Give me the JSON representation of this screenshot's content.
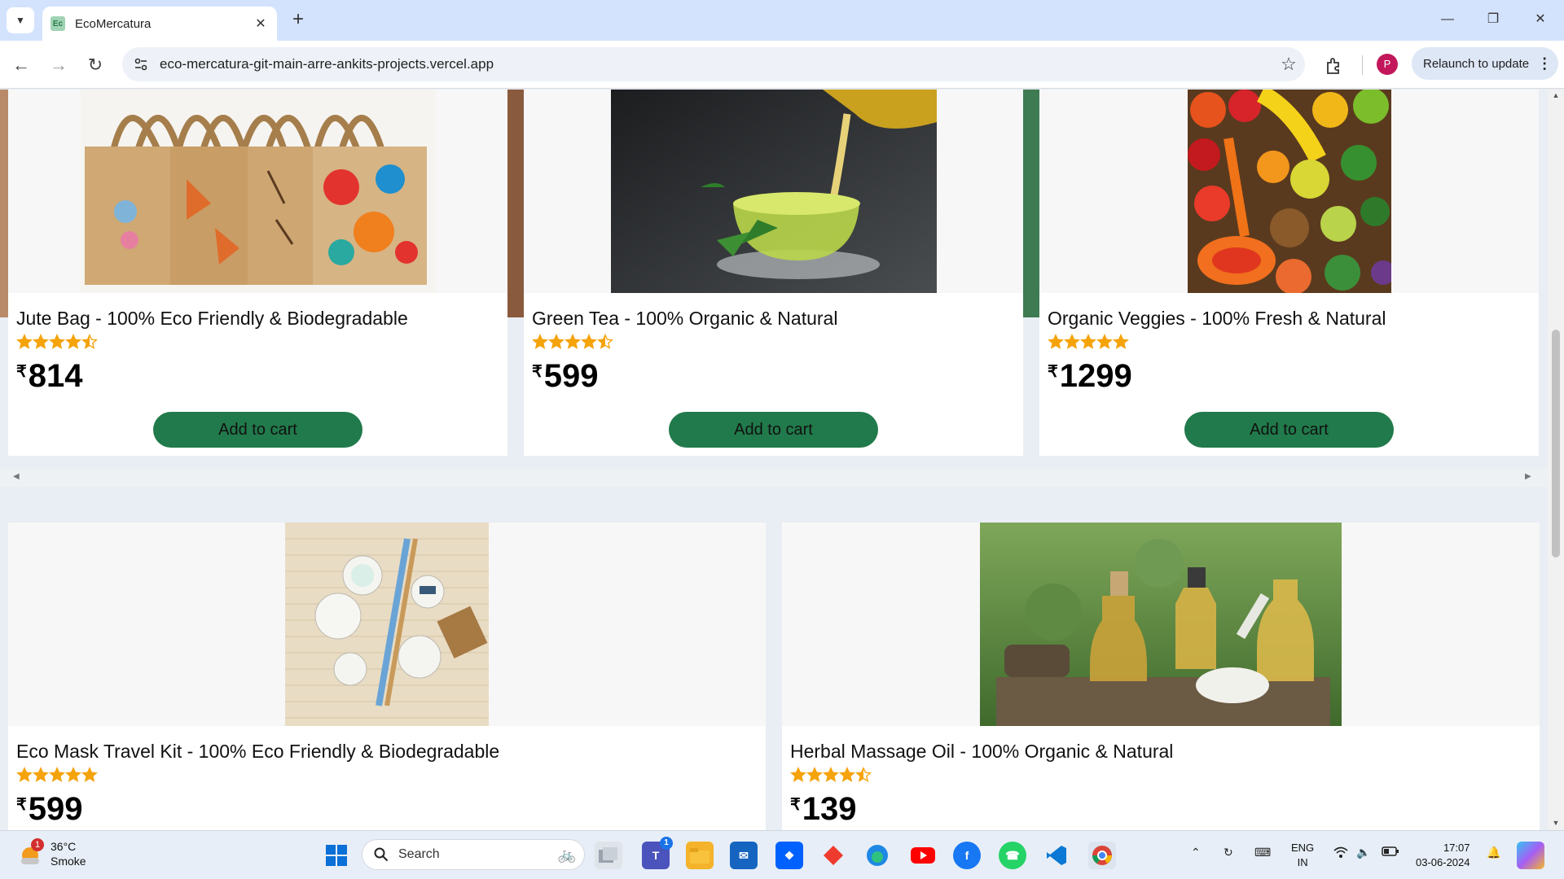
{
  "browser": {
    "tab_title": "EcoMercatura",
    "favicon_text": "Ec",
    "url": "eco-mercatura-git-main-arre-ankits-projects.vercel.app",
    "relaunch_label": "Relaunch to update",
    "profile_initial": "P"
  },
  "products_row1": [
    {
      "name": "Jute Bag - 100% Eco Friendly & Biodegradable",
      "rating": 4.5,
      "currency": "₹",
      "price": "814",
      "button": "Add to cart"
    },
    {
      "name": "Green Tea - 100% Organic & Natural",
      "rating": 4.5,
      "currency": "₹",
      "price": "599",
      "button": "Add to cart"
    },
    {
      "name": "Organic Veggies - 100% Fresh & Natural",
      "rating": 5,
      "currency": "₹",
      "price": "1299",
      "button": "Add to cart"
    }
  ],
  "products_row2": [
    {
      "name": "Eco Mask Travel Kit - 100% Eco Friendly & Biodegradable",
      "rating": 5,
      "currency": "₹",
      "price": "599"
    },
    {
      "name": "Herbal Massage Oil - 100% Organic & Natural",
      "rating": 4.5,
      "currency": "₹",
      "price": "139"
    }
  ],
  "colors": {
    "accent": "#217a4b",
    "star": "#f5a30a"
  },
  "taskbar": {
    "weather_temp": "36°C",
    "weather_desc": "Smoke",
    "weather_badge": "1",
    "search_label": "Search",
    "teams_badge": "1",
    "lang_top": "ENG",
    "lang_bottom": "IN",
    "time": "17:07",
    "date": "03-06-2024",
    "apps": [
      "windows-start",
      "search",
      "task-view",
      "teams",
      "file-explorer",
      "mail",
      "dropbox",
      "anydesk",
      "edge",
      "youtube",
      "facebook",
      "whatsapp",
      "vscode",
      "chrome"
    ]
  }
}
